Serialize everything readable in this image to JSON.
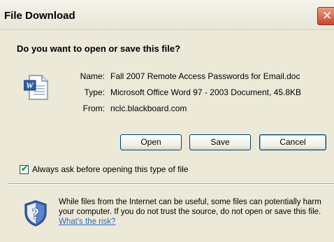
{
  "dialog": {
    "title": "File Download",
    "heading": "Do you want to open or save this file?",
    "fields": [
      {
        "label": "Name:",
        "value": "Fall 2007 Remote Access Passwords for Email.doc"
      },
      {
        "label": "Type:",
        "value": "Microsoft Office Word 97 - 2003 Document, 45.8KB"
      },
      {
        "label": "From:",
        "value": "nclc.blackboard.com"
      }
    ],
    "buttons": {
      "open_label": "Open",
      "save_label": "Save",
      "cancel_label": "Cancel"
    },
    "always_ask": {
      "label": "Always ask before opening this type of file",
      "checked": true
    },
    "warning": {
      "text": "While files from the Internet can be useful, some files can potentially harm your computer. If you do not trust the source, do not open or save this file.",
      "link_label": "What's the risk?"
    },
    "icons": {
      "close": "close-icon",
      "document": "word-document-icon",
      "security": "security-shield-icon"
    },
    "colors": {
      "window_bg": "#ece9d8",
      "close_button": "#c94a2c",
      "link": "#3169c6"
    }
  }
}
